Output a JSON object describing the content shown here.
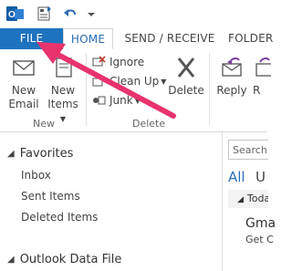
{
  "tabs": {
    "file": "FILE",
    "home": "HOME",
    "send_receive": "SEND / RECEIVE",
    "folder": "FOLDER"
  },
  "ribbon": {
    "new_email": [
      "New",
      "Email"
    ],
    "new_items": [
      "New",
      "Items"
    ],
    "new_group_label": "New",
    "ignore": "Ignore",
    "clean_up": "Clean Up",
    "junk": "Junk",
    "delete": "Delete",
    "delete_group_label": "Delete",
    "reply": "Reply",
    "reply_all_partial": "R"
  },
  "nav": {
    "favorites": "Favorites",
    "items": [
      "Inbox",
      "Sent Items",
      "Deleted Items"
    ],
    "data_file": "Outlook Data File"
  },
  "list": {
    "search_placeholder": "Search C",
    "filter_all": "All",
    "filter_unread_partial": "U",
    "group_today": "Toda",
    "mail_from": "Gma",
    "mail_subject": "Get C"
  },
  "colors": {
    "file_tab": "#1e73be",
    "accent": "#2a6db4",
    "annotation_arrow": "#e8336d"
  }
}
